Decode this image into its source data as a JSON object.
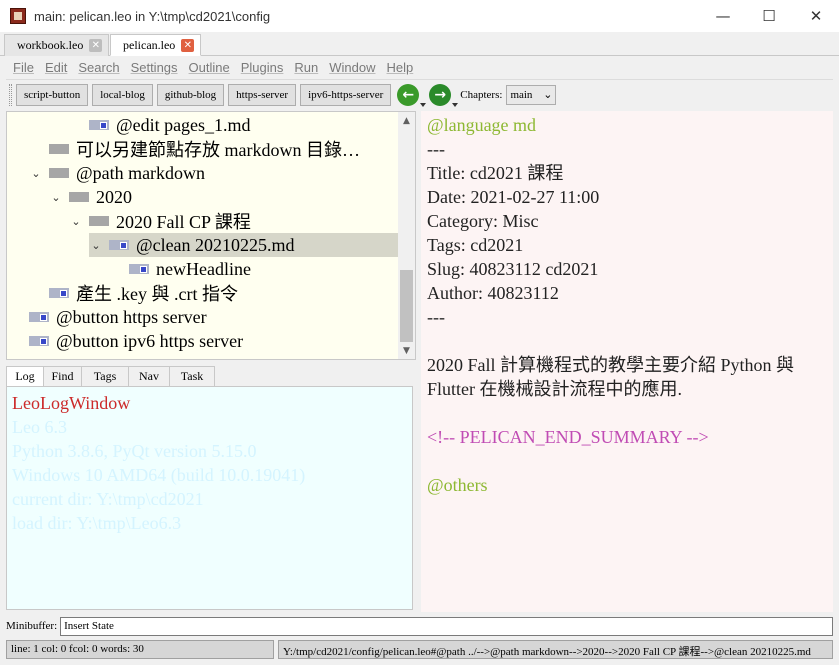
{
  "window": {
    "title": "main: pelican.leo in Y:\\tmp\\cd2021\\config",
    "controls": {
      "minimize": "—",
      "maximize": "☐",
      "close": "✕"
    }
  },
  "tabs": [
    {
      "label": "workbook.leo",
      "close_glyph": "✕",
      "close_color": "#bdbdbd"
    },
    {
      "label": "pelican.leo",
      "close_glyph": "✕",
      "close_color": "#e06040"
    }
  ],
  "menu": [
    "File",
    "Edit",
    "Search",
    "Settings",
    "Outline",
    "Plugins",
    "Run",
    "Window",
    "Help"
  ],
  "toolbar": {
    "buttons": [
      "script-button",
      "local-blog",
      "github-blog",
      "https-server",
      "ipv6-https-server"
    ],
    "back_icon": "←",
    "forward_icon": "→",
    "chapters_label": "Chapters:",
    "chapters_value": "main",
    "dropdown_glyph": "⌄"
  },
  "outline": {
    "nodes": [
      {
        "text": "@edit pages_1.md",
        "twist": "",
        "icon": "doc"
      },
      {
        "text": "可以另建節點存放 markdown 目錄…",
        "twist": "",
        "icon": "plain"
      },
      {
        "text": "@path markdown",
        "twist": "⌄",
        "icon": "plain"
      },
      {
        "text": "2020",
        "twist": "⌄",
        "icon": "plain"
      },
      {
        "text": "2020 Fall CP 課程",
        "twist": "⌄",
        "icon": "plain"
      },
      {
        "text": "@clean 20210225.md",
        "twist": "⌄",
        "icon": "doc",
        "selected": true
      },
      {
        "text": "newHeadline",
        "twist": "",
        "icon": "doc"
      },
      {
        "text": "產生 .key 與 .crt 指令",
        "twist": "",
        "icon": "doc"
      },
      {
        "text": "@button https server",
        "twist": "",
        "icon": "doc"
      },
      {
        "text": "@button ipv6 https server",
        "twist": "",
        "icon": "doc"
      }
    ],
    "scroll_up": "▲",
    "scroll_down": "▼"
  },
  "log": {
    "tabs": [
      "Log",
      "Find",
      "Tags",
      "Nav",
      "Task"
    ],
    "lines": [
      "LeoLogWindow",
      "Leo 6.3",
      "Python 3.8.6, PyQt version 5.15.0",
      "Windows 10 AMD64 (build 10.0.19041)",
      "current dir: Y:\\tmp\\cd2021",
      "load dir: Y:\\tmp\\Leo6.3"
    ]
  },
  "body": {
    "lines": [
      {
        "text": "@language md",
        "style": "green"
      },
      {
        "text": "---",
        "style": ""
      },
      {
        "text": "Title: cd2021 課程",
        "style": ""
      },
      {
        "text": "Date: 2021-02-27 11:00",
        "style": ""
      },
      {
        "text": "Category: Misc",
        "style": ""
      },
      {
        "text": "Tags: cd2021",
        "style": ""
      },
      {
        "text": "Slug: 40823112 cd2021",
        "style": ""
      },
      {
        "text": "Author: 40823112",
        "style": ""
      },
      {
        "text": "---",
        "style": ""
      },
      {
        "text": "",
        "style": ""
      },
      {
        "text": "2020 Fall 計算機程式的教學主要介紹 Python 與 Flutter 在機械設計流程中的應用.",
        "style": "wrap"
      },
      {
        "text": "",
        "style": ""
      },
      {
        "text": "<!-- PELICAN_END_SUMMARY -->",
        "style": "magenta"
      },
      {
        "text": "",
        "style": ""
      },
      {
        "text": "@others",
        "style": "green"
      }
    ]
  },
  "minibuffer": {
    "label": "Minibuffer:",
    "value": "Insert State"
  },
  "status": {
    "left": "line: 1 col: 0  fcol: 0 words: 30",
    "right": "Y:/tmp/cd2021/config/pelican.leo#@path ../-->@path markdown-->2020-->2020 Fall CP 課程-->@clean 20210225.md"
  },
  "colors": {
    "outline_bg": "#fffff0",
    "body_bg": "#fdf4f4",
    "log_bg": "#f0ffff",
    "back_button": "#3a9a2a",
    "forward_button": "#2a8a2a"
  }
}
